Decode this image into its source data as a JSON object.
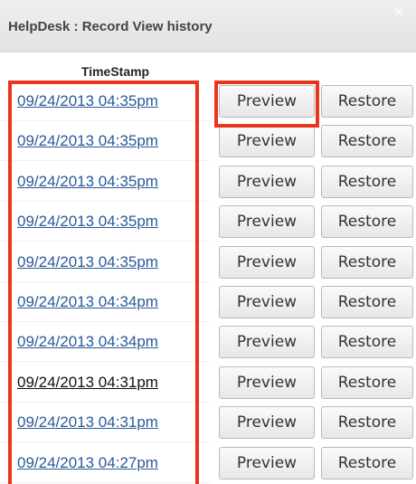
{
  "dialog": {
    "title": "HelpDesk : Record View history",
    "close_symbol": "×"
  },
  "table": {
    "column_header": "TimeStamp",
    "preview_label": "Preview",
    "restore_label": "Restore",
    "rows": [
      {
        "timestamp": "09/24/2013 04:35pm",
        "visited": false
      },
      {
        "timestamp": "09/24/2013 04:35pm",
        "visited": false
      },
      {
        "timestamp": "09/24/2013 04:35pm",
        "visited": false
      },
      {
        "timestamp": "09/24/2013 04:35pm",
        "visited": false
      },
      {
        "timestamp": "09/24/2013 04:35pm",
        "visited": false
      },
      {
        "timestamp": "09/24/2013 04:34pm",
        "visited": false
      },
      {
        "timestamp": "09/24/2013 04:34pm",
        "visited": false
      },
      {
        "timestamp": "09/24/2013 04:31pm",
        "visited": true
      },
      {
        "timestamp": "09/24/2013 04:31pm",
        "visited": false
      },
      {
        "timestamp": "09/24/2013 04:27pm",
        "visited": false
      }
    ]
  },
  "colors": {
    "link": "#2b5a98",
    "highlight": "#e8351f"
  },
  "icons": {
    "close": "close-icon"
  }
}
